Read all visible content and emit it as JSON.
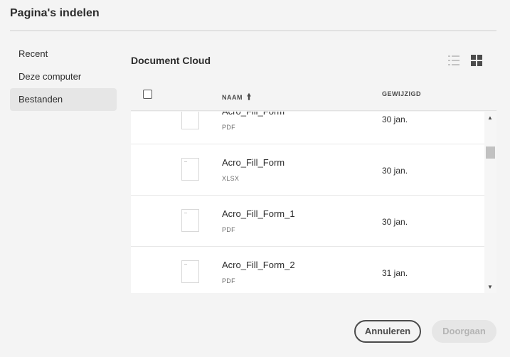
{
  "dialog": {
    "title": "Pagina's indelen"
  },
  "sidebar": {
    "items": [
      {
        "label": "Recent"
      },
      {
        "label": "Deze computer"
      },
      {
        "label": "Bestanden"
      }
    ]
  },
  "content": {
    "title": "Document Cloud",
    "columns": {
      "name": "NAAM",
      "modified": "GEWIJZIGD"
    },
    "sort": {
      "column": "name",
      "direction": "ascending",
      "icon": "arrow-up-icon"
    }
  },
  "files": [
    {
      "name": "Acro_Fill_Form",
      "type": "PDF",
      "modified": "30 jan."
    },
    {
      "name": "Acro_Fill_Form",
      "type": "XLSX",
      "modified": "30 jan."
    },
    {
      "name": "Acro_Fill_Form_1",
      "type": "PDF",
      "modified": "30 jan."
    },
    {
      "name": "Acro_Fill_Form_2",
      "type": "PDF",
      "modified": "31 jan."
    }
  ],
  "buttons": {
    "cancel": "Annuleren",
    "continue": "Doorgaan"
  },
  "colors": {
    "accent_text": "#2c2c2c",
    "disabled_button": "#e6e6e6",
    "background": "#f4f4f4"
  }
}
